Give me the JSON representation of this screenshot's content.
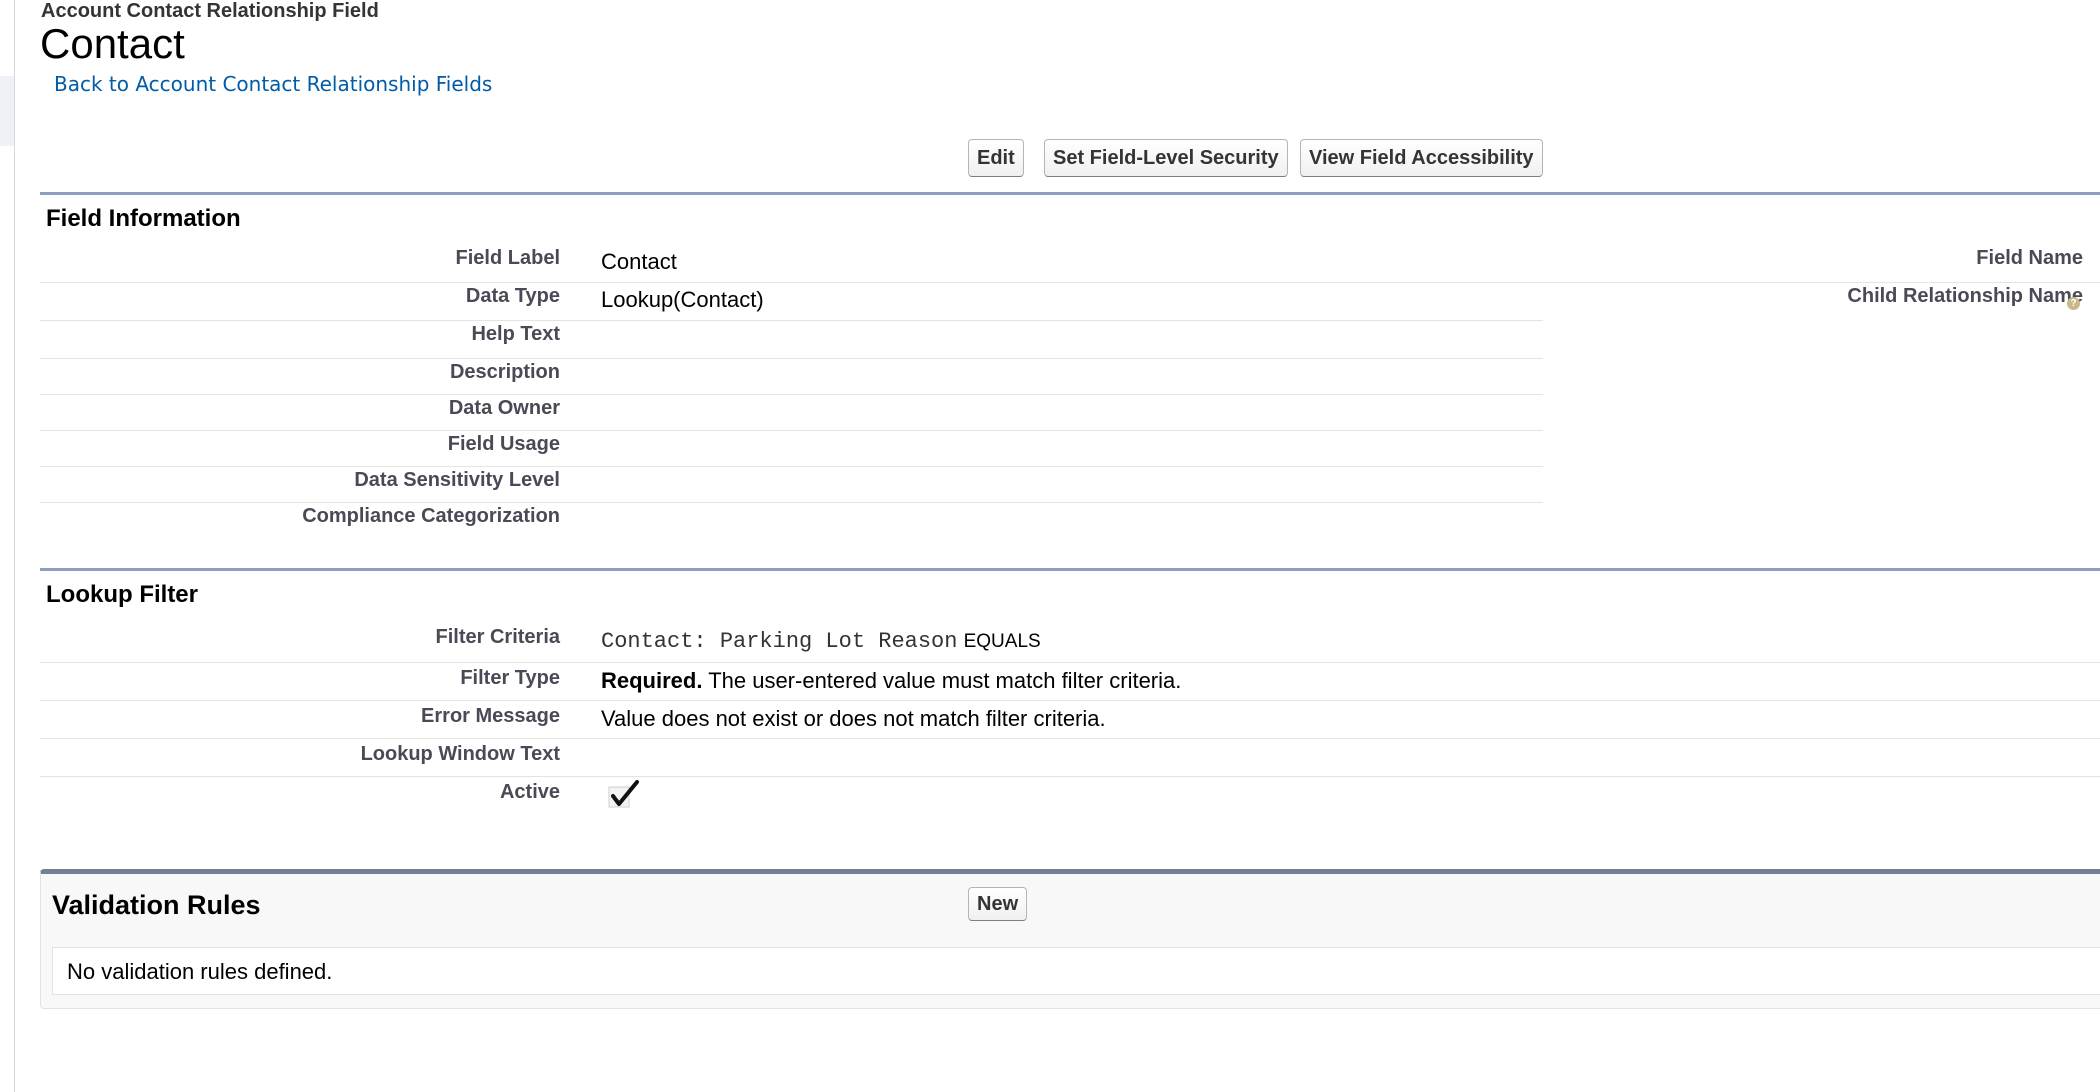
{
  "header": {
    "breadcrumb": "Account Contact Relationship Field",
    "title": "Contact",
    "back_link": "Back to Account Contact Relationship Fields"
  },
  "toolbar": {
    "edit_label": "Edit",
    "field_level_security_label": "Set Field-Level Security",
    "view_accessibility_label": "View Field Accessibility"
  },
  "field_information": {
    "title": "Field Information",
    "rows": [
      {
        "label": "Field Label",
        "value": "Contact"
      },
      {
        "label": "Data Type",
        "value": "Lookup(Contact)"
      },
      {
        "label": "Help Text",
        "value": ""
      },
      {
        "label": "Description",
        "value": ""
      },
      {
        "label": "Data Owner",
        "value": ""
      },
      {
        "label": "Field Usage",
        "value": ""
      },
      {
        "label": "Data Sensitivity Level",
        "value": ""
      },
      {
        "label": "Compliance Categorization",
        "value": ""
      }
    ],
    "right_rows": [
      {
        "label": "Field Name"
      },
      {
        "label": "Child Relationship Name"
      }
    ]
  },
  "lookup_filter": {
    "title": "Lookup Filter",
    "filter_criteria_label": "Filter Criteria",
    "filter_criteria_field": "Contact: Parking Lot Reason",
    "filter_criteria_operator": "EQUALS",
    "filter_type_label": "Filter Type",
    "filter_type_strong": "Required.",
    "filter_type_text": "The user-entered value must match filter criteria.",
    "error_message_label": "Error Message",
    "error_message_value": "Value does not exist or does not match filter criteria.",
    "lookup_window_text_label": "Lookup Window Text",
    "lookup_window_text_value": "",
    "active_label": "Active",
    "active_checked": true,
    "active_icon": "checkmark-icon"
  },
  "validation_rules": {
    "title": "Validation Rules",
    "new_label": "New",
    "empty_text": "No validation rules defined."
  },
  "icons": {
    "help": "help-icon"
  },
  "colors": {
    "link": "#015ba7",
    "section_border": "#8e9dbe",
    "related_list_border": "#747e96",
    "label_text": "#4a4a56"
  }
}
